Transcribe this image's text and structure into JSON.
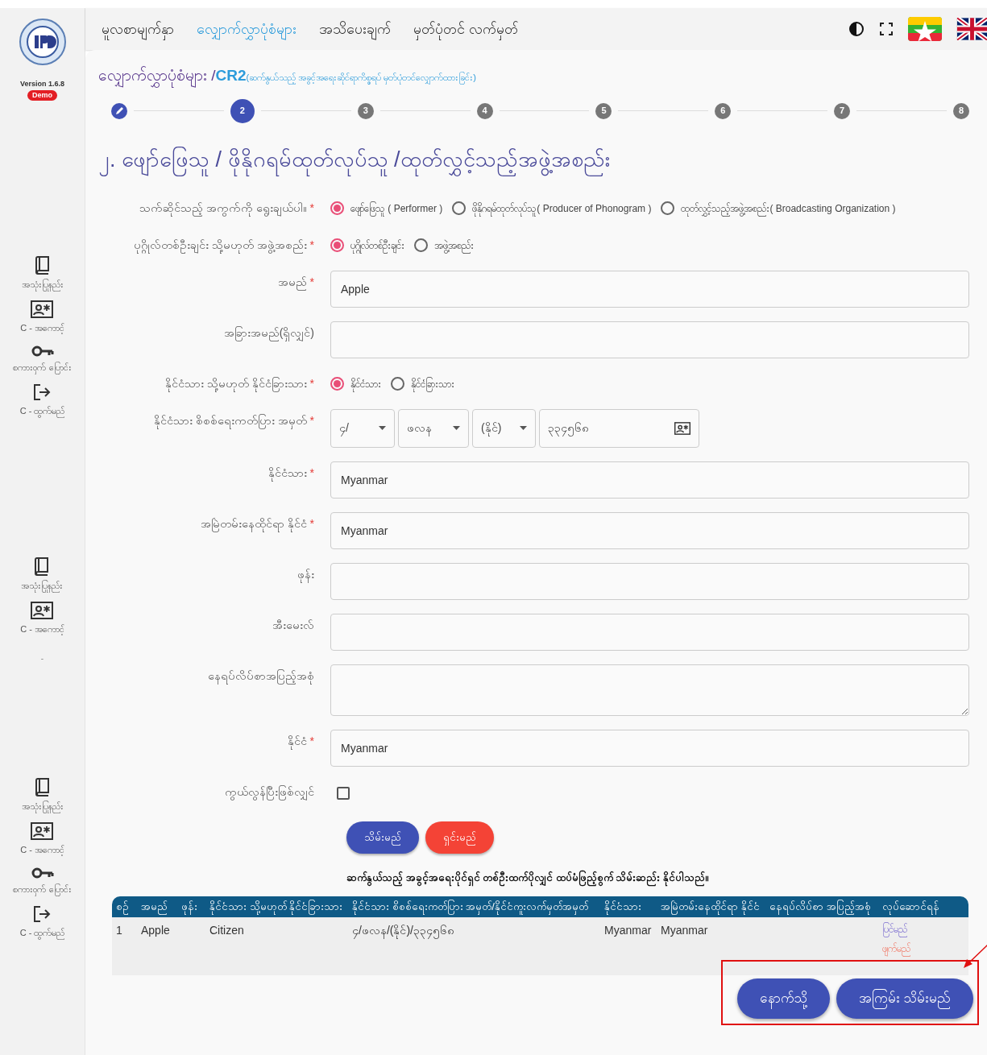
{
  "sidebar": {
    "version": "Version 1.6.8",
    "badge": "Demo",
    "groups": [
      {
        "items": [
          {
            "kind": "book",
            "label": "အသုံးပြုနည်း"
          },
          {
            "kind": "id-card",
            "label": "C - အကောင့်"
          },
          {
            "kind": "key",
            "label": "စကားဝှက် ပြောင်း"
          },
          {
            "kind": "logout",
            "label": "C - ထွက်မည်"
          }
        ]
      },
      {
        "items": [
          {
            "kind": "book",
            "label": "အသုံးပြုနည်း"
          },
          {
            "kind": "id-card",
            "label": "C - အကောင့်"
          }
        ],
        "note": "-"
      },
      {
        "items": [
          {
            "kind": "book",
            "label": "အသုံးပြုနည်း"
          },
          {
            "kind": "id-card",
            "label": "C - အကောင့်"
          },
          {
            "kind": "key",
            "label": "စကားဝှက် ပြောင်း"
          },
          {
            "kind": "logout",
            "label": "C - ထွက်မည်"
          }
        ]
      }
    ]
  },
  "nav": {
    "items": [
      {
        "label": "မူလစာမျက်နှာ",
        "selected": false
      },
      {
        "label": "လျှောက်လွှာပုံစံများ",
        "selected": true
      },
      {
        "label": "အသိပေးချက်",
        "selected": false
      },
      {
        "label": "မှတ်ပုံတင် လက်မှတ်",
        "selected": false
      }
    ]
  },
  "breadcrumb": {
    "section": "လျှောက်လွှာပုံစံများ /",
    "code": "CR2",
    "description": "(ဆက်နွယ်သည့် အခွင့်အရေးဆိုင်ရာကိစ္စရပ် မှတ်ပုံတင်လျှောက်ထားခြင်း)"
  },
  "stepper": [
    {
      "done": true,
      "selected": false
    },
    {
      "number": "2",
      "done": false,
      "selected": true
    },
    {
      "number": "3",
      "done": false,
      "selected": false
    },
    {
      "number": "4",
      "done": false,
      "selected": false
    },
    {
      "number": "5",
      "done": false,
      "selected": false
    },
    {
      "number": "6",
      "done": false,
      "selected": false
    },
    {
      "number": "7",
      "done": false,
      "selected": false
    },
    {
      "number": "8",
      "done": false,
      "selected": false
    }
  ],
  "heading": "၂. ဖျော်ဖြေသူ / ဖိုနိုဂရမ်ထုတ်လုပ်သူ /ထုတ်လွှင့်သည့်အဖွဲ့အစည်း",
  "form": {
    "fields": [
      {
        "kind": "radio",
        "label": "သက်ဆိုင်သည့် အကွက်ကို ရွေးချယ်ပါ။",
        "required_mark": "*",
        "options": [
          {
            "label": "ဖျော်ဖြေသူ ( Performer )",
            "selected": true
          },
          {
            "label": "ဖိုနိုဂရမ်ထုတ်လုပ်သူ( Producer of Phonogram )",
            "selected": false
          },
          {
            "label": "ထုတ်လွှင့်သည့်အဖွဲ့အစည်း( Broadcasting Organization )",
            "selected": false
          }
        ]
      },
      {
        "kind": "radio",
        "label": "ပုဂ္ဂိုလ်တစ်ဦးချင်း သို့မဟုတ် အဖွဲ့အစည်း",
        "required_mark": "*",
        "options": [
          {
            "label": "ပုဂ္ဂိုလ်တစ်ဦးချင်း",
            "selected": true
          },
          {
            "label": "အဖွဲ့အစည်း",
            "selected": false
          }
        ]
      },
      {
        "kind": "text",
        "label": "အမည်",
        "required_mark": "*",
        "value": "Apple"
      },
      {
        "kind": "text",
        "label": "အခြားအမည်(ရှိလျှင်)"
      },
      {
        "kind": "radio",
        "label": "နိုင်ငံသား သို့မဟုတ် နိုင်ငံခြားသား",
        "required_mark": "*",
        "options": [
          {
            "label": "နိုင်ငံသား",
            "selected": true
          },
          {
            "label": "နိုင်ငံခြားသား",
            "selected": false
          }
        ]
      },
      {
        "kind": "nrc",
        "label": "နိုင်ငံသား စိစစ်ရေးကတ်ပြား အမှတ်",
        "required_mark": "*",
        "selects": [
          "၄/",
          "ဖလန",
          "(နိုင်)"
        ],
        "value": "၃၃၄၅၆၈"
      },
      {
        "kind": "text",
        "label": "နိုင်ငံသား",
        "required_mark": "*",
        "value": "Myanmar"
      },
      {
        "kind": "text",
        "label": "အမြဲတမ်းနေထိုင်ရာ နိုင်ငံ",
        "required_mark": "*",
        "value": "Myanmar"
      },
      {
        "kind": "text",
        "label": "ဖုန်း"
      },
      {
        "kind": "text",
        "label": "အီးမေးလ်"
      },
      {
        "kind": "textarea",
        "label": "နေရပ်လိပ်စာအပြည့်အစုံ"
      },
      {
        "kind": "text",
        "label": "နိုင်ငံ",
        "required_mark": "*",
        "value": "Myanmar"
      },
      {
        "kind": "checkbox",
        "label": "ကွယ်လွန်ပြီးဖြစ်လျှင်",
        "checked": false
      }
    ],
    "buttons": [
      {
        "label": "သိမ်းမည်",
        "kind": "primary"
      },
      {
        "label": "ရှင်းမည်",
        "kind": "danger"
      }
    ],
    "note": "ဆက်နွယ်သည့် အခွင့်အရေးပိုင်ရှင် တစ်ဦးထက်ပိုလျှင် ထပ်မံဖြည့်စွက် သိမ်းဆည်း နိုင်ပါသည်။"
  },
  "table": {
    "columns": [
      "စဉ်",
      "အမည်",
      "ဖုန်း",
      "နိုင်ငံသား သို့မဟုတ် နိုင်ငံခြားသား",
      "နိုင်ငံသား စိစစ်ရေးကတ်ပြား အမှတ်/နိုင်ငံကူးလက်မှတ်အမှတ်",
      "နိုင်ငံသား",
      "အမြဲတမ်းနေထိုင်ရာ နိုင်ငံ",
      "နေရပ်လိပ်စာ အပြည့်အစုံ",
      "လုပ်ဆောင်ရန်"
    ],
    "rows": [
      {
        "cells": [
          "1",
          "Apple",
          null,
          "Citizen",
          "၄/ဖလန/(နိုင်)/၃၃၄၅၆၈",
          "Myanmar",
          "Myanmar",
          null
        ],
        "actions": [
          {
            "label": "ပြင်မည်",
            "kind": "edit"
          },
          {
            "label": "ဖျက်မည်",
            "kind": "delete"
          }
        ]
      }
    ]
  },
  "footer_buttons": [
    {
      "label": "နောက်သို့"
    },
    {
      "label": "အကြမ်း သိမ်းမည်"
    }
  ]
}
